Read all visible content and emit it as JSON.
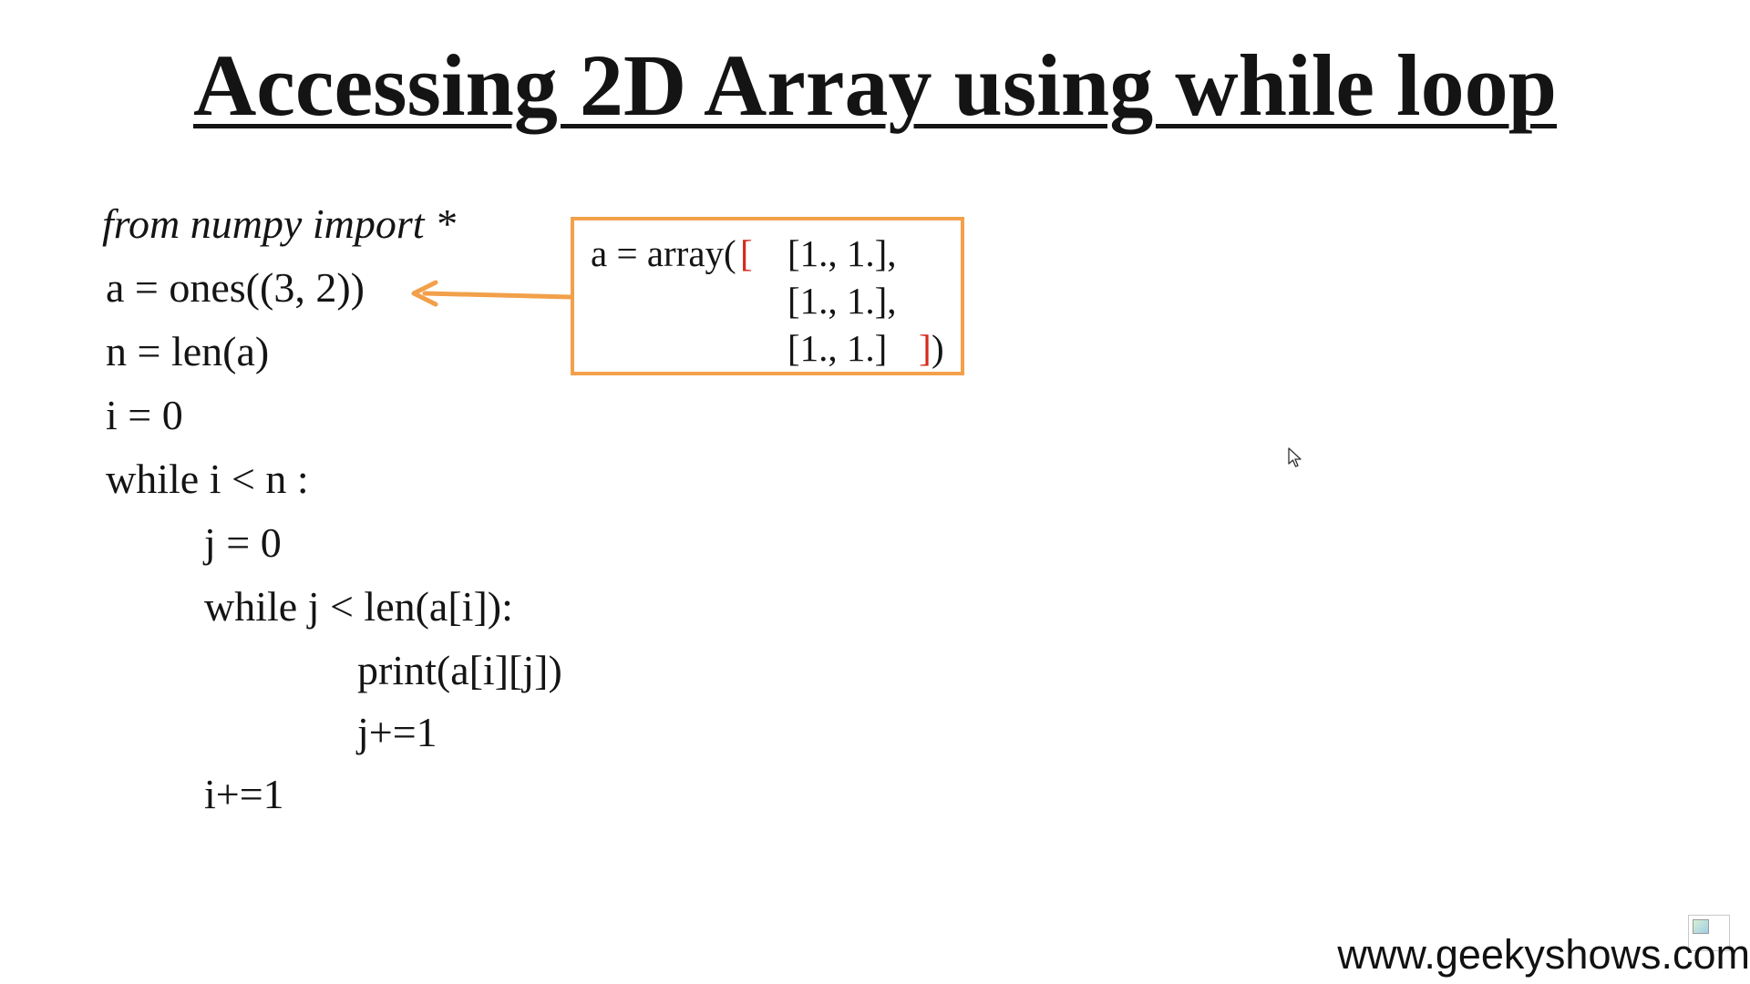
{
  "slide": {
    "title": "Accessing 2D Array using while loop",
    "code_lines": [
      "from numpy import *",
      "a = ones((3, 2))",
      "n = len(a)",
      "i = 0",
      "while  i < n :",
      "j = 0",
      "while j < len(a[i]):",
      "print(a[i][j])",
      "j+=1",
      "i+=1"
    ],
    "callout": {
      "prefix": "a = array(",
      "open_bracket": "[",
      "rows": [
        "[1., 1.],",
        "[1., 1.],",
        "[1., 1.]"
      ],
      "close_bracket": "]",
      "close_paren": ")"
    },
    "footer": "www.geekyshows.com"
  },
  "colors": {
    "box_border": "#f2a04a",
    "arrow": "#f2a04a",
    "bracket": "#d42a1c",
    "text": "#141414"
  },
  "icons": {
    "arrow": "arrow-left-icon",
    "cursor": "mouse-cursor-icon",
    "broken_image": "broken-image-icon"
  }
}
